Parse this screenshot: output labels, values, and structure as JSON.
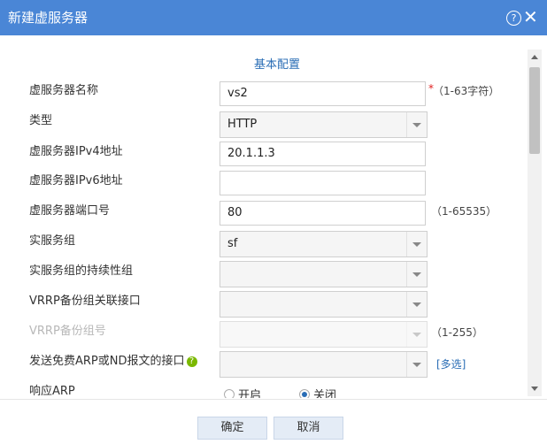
{
  "dialog": {
    "title": "新建虚服务器"
  },
  "section": {
    "title": "基本配置"
  },
  "fields": {
    "name": {
      "label": "虚服务器名称",
      "value": "vs2",
      "hint": "（1-63字符）",
      "required": "*"
    },
    "type": {
      "label": "类型",
      "value": "HTTP"
    },
    "ipv4": {
      "label": "虚服务器IPv4地址",
      "value": "20.1.1.3"
    },
    "ipv6": {
      "label": "虚服务器IPv6地址",
      "value": ""
    },
    "port": {
      "label": "虚服务器端口号",
      "value": "80",
      "hint": "（1-65535）"
    },
    "real_group": {
      "label": "实服务组",
      "value": "sf"
    },
    "persist_group": {
      "label": "实服务组的持续性组",
      "value": ""
    },
    "vrrp_if": {
      "label": "VRRP备份组关联接口",
      "value": ""
    },
    "vrrp_id": {
      "label": "VRRP备份组号",
      "value": "",
      "hint": "（1-255）"
    },
    "garp_if": {
      "label": "发送免费ARP或ND报文的接口",
      "value": "",
      "help_icon": "?",
      "multi": "[多选]"
    },
    "arp": {
      "label": "响应ARP",
      "on": "开启",
      "off": "关闭",
      "selected": "off"
    }
  },
  "buttons": {
    "ok": "确定",
    "cancel": "取消"
  },
  "icons": {
    "help": "help-icon",
    "close": "close-icon"
  },
  "colors": {
    "titlebar": "#4a86d6",
    "link": "#2a6db5"
  }
}
